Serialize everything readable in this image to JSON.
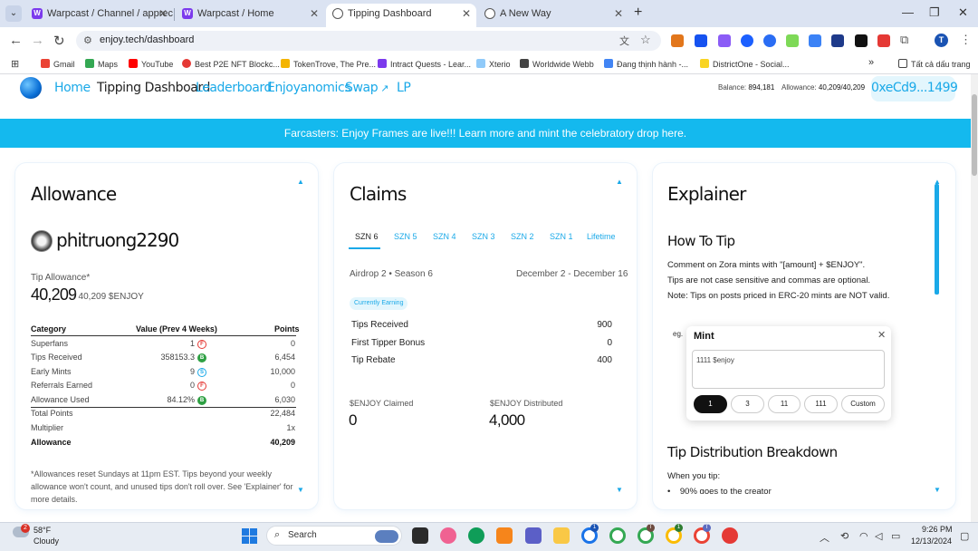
{
  "browser": {
    "tabs": [
      {
        "title": "Warpcast / Channel / appreciati",
        "active": false
      },
      {
        "title": "Warpcast / Home",
        "active": false
      },
      {
        "title": "Tipping Dashboard",
        "active": true
      },
      {
        "title": "A New Way",
        "active": false
      }
    ],
    "url": "enjoy.tech/dashboard",
    "profile_initial": "T",
    "bookmarks": [
      "Gmail",
      "Maps",
      "YouTube",
      "Best P2E NFT Blockc...",
      "TokenTrove, The Pre...",
      "Intract Quests - Lear...",
      "Xterio",
      "Worldwide Webb",
      "Đang thịnh hành -...",
      "DistrictOne - Social..."
    ],
    "all_bookmarks_label": "Tất cả dấu trang"
  },
  "nav": {
    "items": [
      "Home",
      "Tipping Dashboard",
      "Leaderboard",
      "Enjoyanomics",
      "Swap",
      "LP"
    ],
    "balance_label": "Balance:",
    "balance_value": "894,181",
    "allowance_label": "Allowance:",
    "allowance_value": "40,209/40,209",
    "wallet": "0xeCd9...1499"
  },
  "banner": "Farcasters: Enjoy Frames are live!!! Learn more and mint the celebratory drop here.",
  "allowance_card": {
    "title": "Allowance",
    "username": "phitruong2290",
    "tip_allowance_label": "Tip Allowance*",
    "tip_allowance_value": "40,209",
    "tip_allowance_total": "/ 40,209 $ENJOY",
    "headers": {
      "category": "Category",
      "value": "Value (Prev 4 Weeks)",
      "points": "Points"
    },
    "rows": [
      {
        "category": "Superfans",
        "value": "1",
        "badge": "F",
        "points": "0"
      },
      {
        "category": "Tips Received",
        "value": "358153.3",
        "badge": "B",
        "points": "6,454"
      },
      {
        "category": "Early Mints",
        "value": "9",
        "badge": "S",
        "points": "10,000"
      },
      {
        "category": "Referrals Earned",
        "value": "0",
        "badge": "F",
        "points": "0"
      },
      {
        "category": "Allowance Used",
        "value": "84.12%",
        "badge": "B",
        "points": "6,030"
      }
    ],
    "totals": [
      {
        "label": "Total Points",
        "value": "22,484"
      },
      {
        "label": "Multiplier",
        "value": "1x"
      },
      {
        "label": "Allowance",
        "value": "40,209"
      }
    ],
    "footnote": "*Allowances reset Sundays at 11pm EST. Tips beyond your weekly allowance won't count, and unused tips don't roll over. See 'Explainer' for more details."
  },
  "claims_card": {
    "title": "Claims",
    "seasons": [
      "SZN 6",
      "SZN 5",
      "SZN 4",
      "SZN 3",
      "SZN 2",
      "SZN 1",
      "Lifetime"
    ],
    "airdrop": "Airdrop 2 • Season 6",
    "dates": "December 2 - December 16",
    "status": "Currently Earning",
    "rows": [
      {
        "label": "Tips Received",
        "value": "900"
      },
      {
        "label": "First Tipper Bonus",
        "value": "0"
      },
      {
        "label": "Tip Rebate",
        "value": "400"
      }
    ],
    "claimed_label": "$ENJOY Claimed",
    "claimed_value": "0",
    "distributed_label": "$ENJOY Distributed",
    "distributed_value": "4,000"
  },
  "explainer_card": {
    "title": "Explainer",
    "how_to_tip": "How To Tip",
    "lines": [
      "Comment on Zora mints with \"[amount] + $ENJOY\".",
      "Tips are not case sensitive and commas are optional.",
      "Note: Tips on posts priced in ERC-20 mints are NOT valid."
    ],
    "eg": "eg.",
    "mint_title": "Mint",
    "mint_input": "1111 $enjoy",
    "mint_options": [
      "1",
      "3",
      "11",
      "111",
      "Custom"
    ],
    "breakdown_title": "Tip Distribution Breakdown",
    "when_you_tip": "When you tip:",
    "partial_bullet": "90% goes to the creator"
  },
  "taskbar": {
    "temp": "58°F",
    "condition": "Cloudy",
    "weather_badge": "2",
    "search": "Search",
    "time": "9:26 PM",
    "date": "12/13/2024"
  },
  "colors": {
    "accent": "#1aa9e8",
    "banner": "#14b9ee"
  }
}
